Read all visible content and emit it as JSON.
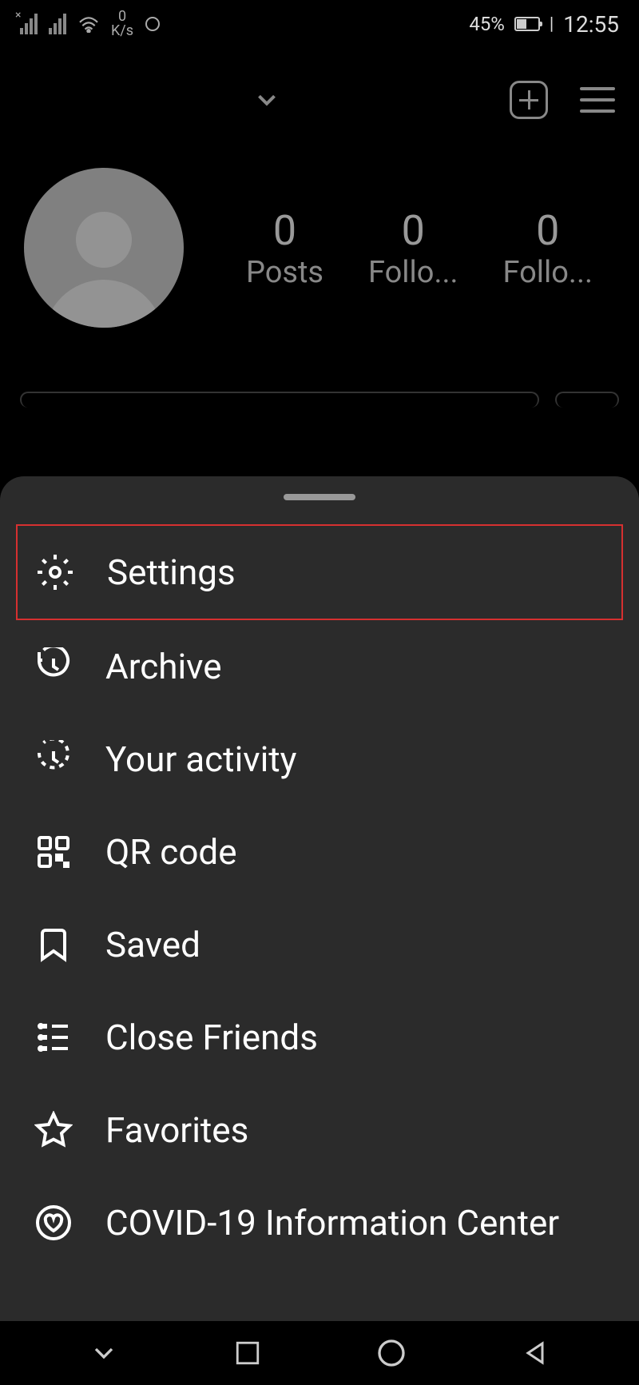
{
  "status": {
    "speed_value": "0",
    "speed_unit": "K/s",
    "battery_percent": "45%",
    "time": "12:55"
  },
  "profile": {
    "posts_count": "0",
    "posts_label": "Posts",
    "followers_count": "0",
    "followers_label": "Follo...",
    "following_count": "0",
    "following_label": "Follo..."
  },
  "menu": {
    "settings": "Settings",
    "archive": "Archive",
    "your_activity": "Your activity",
    "qr_code": "QR code",
    "saved": "Saved",
    "close_friends": "Close Friends",
    "favorites": "Favorites",
    "covid": "COVID-19 Information Center"
  }
}
